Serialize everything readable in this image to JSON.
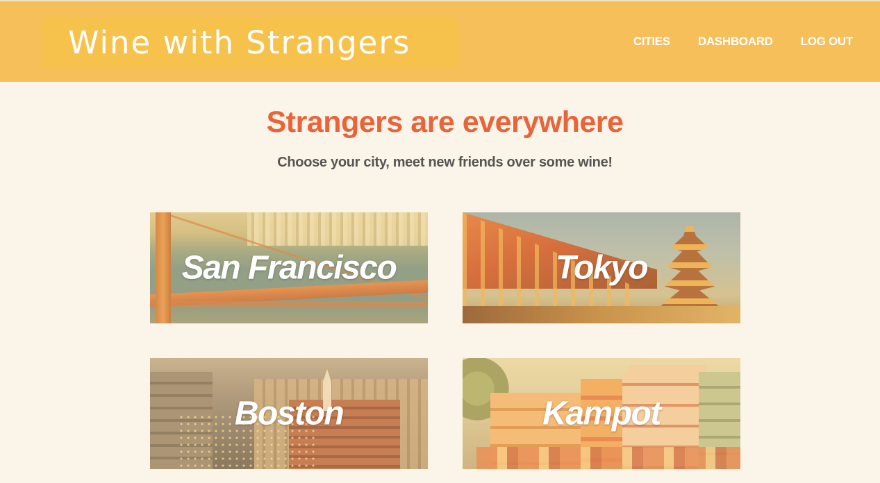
{
  "header": {
    "logo": "Wine with Strangers",
    "nav": {
      "cities": "CITIES",
      "dashboard": "DASHBOARD",
      "logout": "LOG OUT"
    }
  },
  "main": {
    "headline": "Strangers are everywhere",
    "subhead": "Choose your city, meet new friends over some wine!",
    "cities": [
      {
        "name": "San Francisco"
      },
      {
        "name": "Tokyo"
      },
      {
        "name": "Boston"
      },
      {
        "name": "Kampot"
      }
    ]
  },
  "colors": {
    "header_bg": "#f6bf5a",
    "logo_bg": "#f7c24b",
    "page_bg": "#faf5e8",
    "headline": "#e9633b",
    "subhead": "#555555"
  }
}
